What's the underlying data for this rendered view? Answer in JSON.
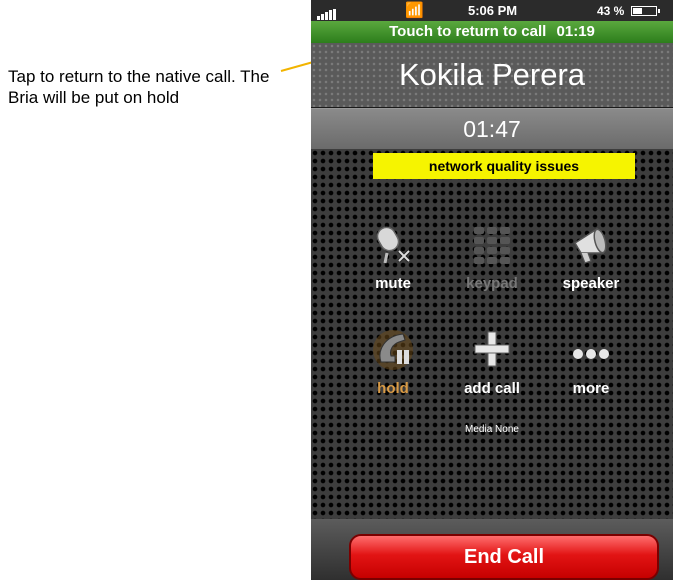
{
  "annotation": {
    "text": "Tap to return to the native call. The Bria will be put on hold"
  },
  "status_bar": {
    "time": "5:06 PM",
    "battery": "43 %",
    "battery_level": 0.43
  },
  "return_banner": {
    "label": "Touch to return to call",
    "duration": "01:19"
  },
  "call": {
    "contact_name": "Kokila Perera",
    "timer": "01:47",
    "warning": "network quality issues"
  },
  "controls": [
    {
      "label": "mute",
      "icon": "microphone-muted-icon",
      "state": "enabled"
    },
    {
      "label": "keypad",
      "icon": "keypad-icon",
      "state": "disabled"
    },
    {
      "label": "speaker",
      "icon": "speaker-icon",
      "state": "enabled"
    },
    {
      "label": "hold",
      "icon": "hold-phone-icon",
      "state": "active"
    },
    {
      "label": "add call",
      "icon": "plus-icon",
      "state": "enabled"
    },
    {
      "label": "more",
      "icon": "more-dots-icon",
      "state": "enabled"
    }
  ],
  "media_status": "Media None",
  "end_call": {
    "label": "End Call"
  },
  "colors": {
    "accent_green": "#3d9a2a",
    "warning_yellow": "#f6f400",
    "end_call_red": "#e21414",
    "hold_orange": "#d89a45"
  }
}
